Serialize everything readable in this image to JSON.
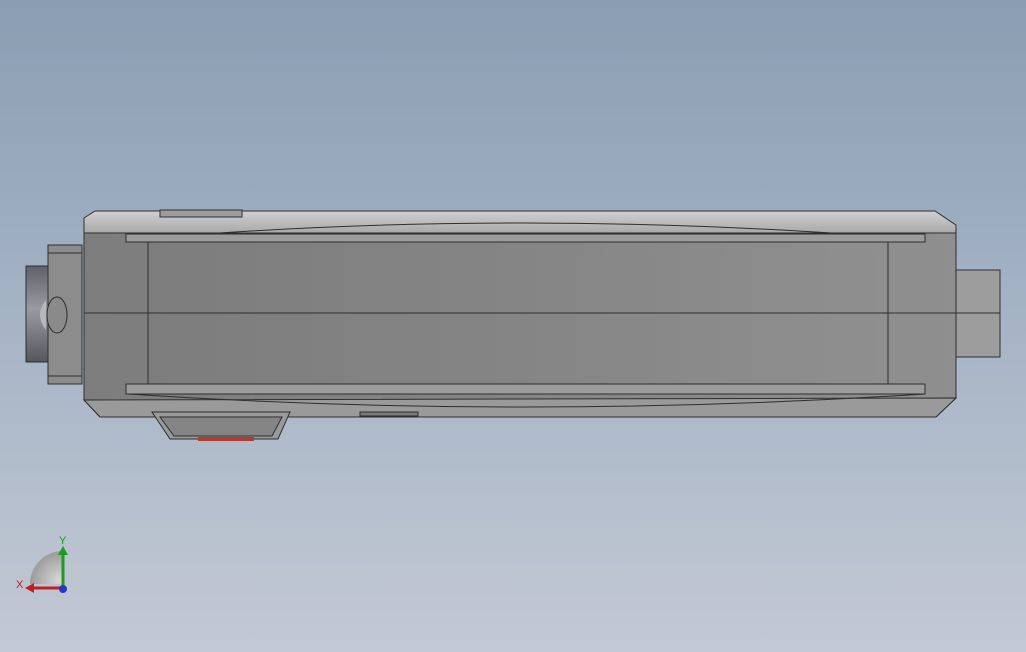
{
  "viewport": {
    "background_top": "#8a9db2",
    "background_bottom": "#c3c9d4"
  },
  "model": {
    "body_color": "#888888",
    "edge_color": "#2e2e2e",
    "highlight_color": "#c7c7c7",
    "accent_red": "#b03a34"
  },
  "triad": {
    "x_label": "X",
    "y_label": "Y",
    "x_color": "#c02020",
    "y_color": "#1e9a1e",
    "z_color": "#2636c8"
  }
}
